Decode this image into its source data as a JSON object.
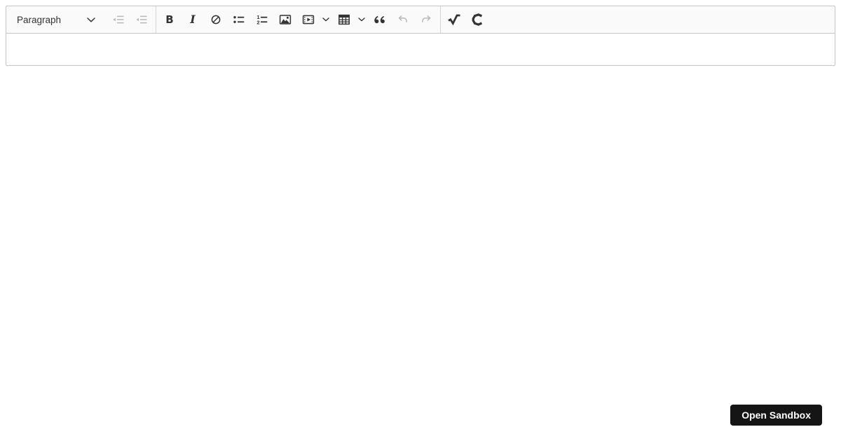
{
  "editor": {
    "toolbar": {
      "heading_dropdown": {
        "label": "Paragraph",
        "icon": "chevron-down-icon",
        "disabled": false
      },
      "items": [
        {
          "name": "outdent",
          "icon": "outdent-icon",
          "disabled": true
        },
        {
          "name": "indent",
          "icon": "indent-icon",
          "disabled": true
        },
        {
          "type": "separator"
        },
        {
          "name": "bold",
          "icon": "bold-icon",
          "disabled": false
        },
        {
          "name": "italic",
          "icon": "italic-icon",
          "disabled": false
        },
        {
          "name": "link",
          "icon": "link-icon",
          "disabled": false
        },
        {
          "name": "bulleted-list",
          "icon": "bulleted-list-icon",
          "disabled": false
        },
        {
          "name": "numbered-list",
          "icon": "numbered-list-icon",
          "disabled": false
        },
        {
          "name": "insert-image",
          "icon": "image-icon",
          "disabled": false
        },
        {
          "name": "media-embed",
          "icon": "media-embed-icon",
          "disabled": false,
          "has_dropdown": true
        },
        {
          "name": "media-embed-dropdown",
          "icon": "chevron-down-icon",
          "disabled": false
        },
        {
          "name": "insert-table",
          "icon": "table-icon",
          "disabled": false,
          "has_dropdown": true
        },
        {
          "name": "insert-table-dropdown",
          "icon": "chevron-down-icon",
          "disabled": false
        },
        {
          "name": "block-quote",
          "icon": "block-quote-icon",
          "disabled": false
        },
        {
          "name": "undo",
          "icon": "undo-icon",
          "disabled": true
        },
        {
          "name": "redo",
          "icon": "redo-icon",
          "disabled": true
        },
        {
          "type": "separator"
        },
        {
          "name": "math",
          "icon": "square-root-icon",
          "disabled": false
        },
        {
          "name": "chemistry",
          "icon": "chemistry-c-icon",
          "disabled": false
        }
      ]
    },
    "content": {
      "text": "",
      "placeholder": ""
    }
  },
  "sandbox_button": {
    "label": "Open Sandbox"
  },
  "colors": {
    "page_background": "#ffffff",
    "toolbar_background": "#fafafa",
    "border": "#c4c4c4",
    "icon_enabled": "#333333",
    "icon_disabled": "#b8b8b8",
    "sandbox_button_background": "#151515",
    "sandbox_button_text": "#ffffff"
  }
}
